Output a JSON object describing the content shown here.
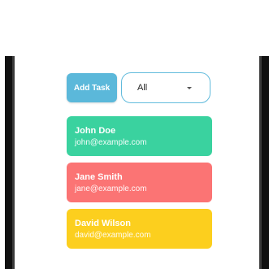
{
  "toolbar": {
    "add_label": "Add Task",
    "filter_value": "All"
  },
  "contacts": [
    {
      "name": "John Doe",
      "email": "john@example.com",
      "color": "#3ad29f"
    },
    {
      "name": "Jane Smith",
      "email": "jane@example.com",
      "color": "#fb7474"
    },
    {
      "name": "David Wilson",
      "email": "david@example.com",
      "color": "#fccf1e"
    }
  ],
  "colors": {
    "accent": "#5bb8da",
    "select_border": "#62bbdc",
    "frame": "#111111"
  }
}
